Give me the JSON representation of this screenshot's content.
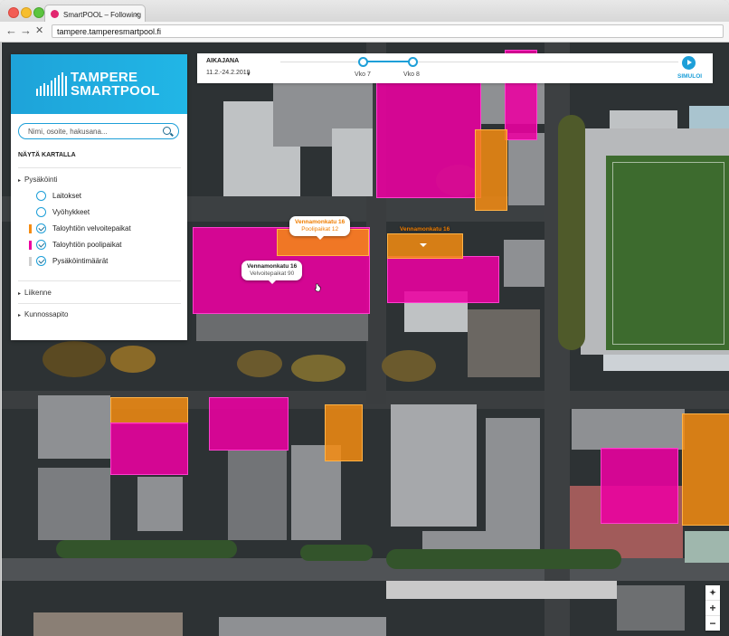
{
  "browser": {
    "tab_title": "SmartPOOL – Following",
    "tab_close": "×",
    "url": "tampere.tamperesmartpool.fi",
    "nav": {
      "back": "←",
      "forward": "→",
      "reload": "✕"
    }
  },
  "timeline": {
    "title": "AIKAJANA",
    "range": "11.2.-24.2.2019",
    "range_caret": "▾",
    "weeks": [
      "Vko 7",
      "Vko 8"
    ],
    "simulate_label": "SIMULOI"
  },
  "panel": {
    "brand_line1": "TAMPERE",
    "brand_line2": "SMARTPOOL",
    "search_placeholder": "Nimi, osoite, hakusana...",
    "section_title": "NÄYTÄ KARTALLA",
    "groups": [
      {
        "label": "Pysäköinti",
        "chevron": "▸",
        "items": [
          {
            "label": "Laitokset",
            "control": "radio",
            "checked": false
          },
          {
            "label": "Vyöhykkeet",
            "control": "radio",
            "checked": false
          },
          {
            "label": "Taloyhtiön velvoitepaikat",
            "control": "check",
            "checked": true,
            "swatch_color": "#f58c12"
          },
          {
            "label": "Taloyhtiön poolipaikat",
            "control": "check",
            "checked": true,
            "swatch_color": "#ec00a0"
          },
          {
            "label": "Pysäköintimäärät",
            "control": "check",
            "checked": true,
            "swatch_color": "#cfcfcf"
          }
        ]
      },
      {
        "label": "Liikenne",
        "chevron": "▸"
      },
      {
        "label": "Kunnossapito",
        "chevron": "▸"
      }
    ]
  },
  "map": {
    "callouts": [
      {
        "title": "Vennamonkatu 16",
        "subtitle": "Poolipaikat 12",
        "style": "orange"
      },
      {
        "title": "Vennamonkatu 16",
        "subtitle": "Velvoitepaikat 90",
        "style": "dark"
      }
    ],
    "flag_label": "Vennamonkatu 16",
    "colors": {
      "pool": "#ec00a0",
      "obligation": "#f58c12",
      "accent": "#1d9fd8"
    },
    "zoom": {
      "compass": "✦",
      "plus": "+",
      "minus": "−"
    }
  }
}
